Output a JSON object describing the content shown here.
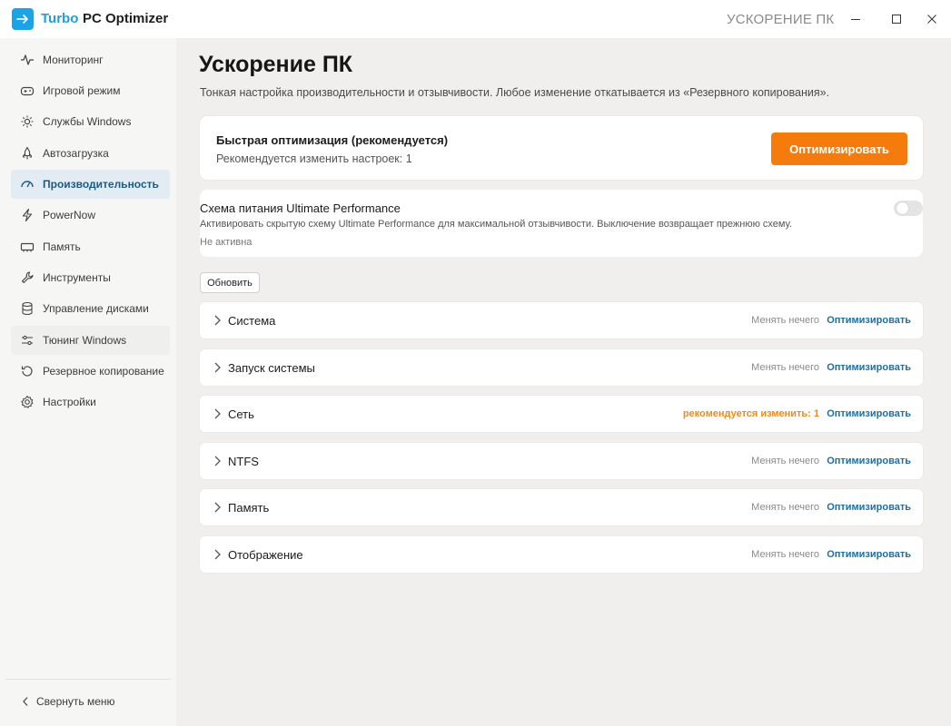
{
  "app": {
    "name_brand": "Turbo",
    "name_rest": "PC Optimizer",
    "window_title": "УСКОРЕНИЕ ПК",
    "accent_color": "#1aa3e6",
    "logo_icon": "arrow-right-icon"
  },
  "window_controls": {
    "minimize_icon": "minimize-icon",
    "maximize_icon": "maximize-icon",
    "close_icon": "close-icon"
  },
  "sidebar": {
    "items": [
      {
        "label": "Мониторинг",
        "icon": "pulse-icon"
      },
      {
        "label": "Игровой режим",
        "icon": "gamepad-icon"
      },
      {
        "label": "Службы Windows",
        "icon": "gear-sun-icon"
      },
      {
        "label": "Автозагрузка",
        "icon": "rocket-icon"
      },
      {
        "label": "Производительность",
        "icon": "speedometer-icon",
        "active": true
      },
      {
        "label": "PowerNow",
        "icon": "lightning-icon"
      },
      {
        "label": "Память",
        "icon": "memory-chip-icon"
      },
      {
        "label": "Инструменты",
        "icon": "wrench-icon"
      },
      {
        "label": "Управление дисками",
        "icon": "database-icon"
      },
      {
        "label": "Тюнинг Windows",
        "icon": "sliders-icon"
      },
      {
        "label": "Резервное копирование",
        "icon": "restore-icon"
      },
      {
        "label": "Настройки",
        "icon": "settings-icon"
      }
    ],
    "collapse_label": "Свернуть меню",
    "collapse_icon": "chevron-left-icon"
  },
  "main": {
    "title": "Ускорение ПК",
    "subtitle": "Тонкая настройка производительности и отзывчивости. Любое изменение откатывается из «Резервного копирования».",
    "quick": {
      "title": "Быстрая оптимизация (рекомендуется)",
      "subtitle": "Рекомендуется изменить настроек: 1",
      "button_label": "Оптимизировать",
      "button_color": "#f57c0c"
    },
    "power": {
      "title": "Схема питания Ultimate Performance",
      "description": "Активировать скрытую схему Ultimate Performance для максимальной отзывчивости. Выключение возвращает прежнюю схему.",
      "status": "Не активна",
      "toggle_on": false
    },
    "refresh_label": "Обновить",
    "sections": [
      {
        "label": "Система",
        "status": "Менять нечего",
        "action": "Оптимизировать",
        "warn": false
      },
      {
        "label": "Запуск системы",
        "status": "Менять нечего",
        "action": "Оптимизировать",
        "warn": false
      },
      {
        "label": "Сеть",
        "status": "рекомендуется изменить: 1",
        "action": "Оптимизировать",
        "warn": true
      },
      {
        "label": "NTFS",
        "status": "Менять нечего",
        "action": "Оптимизировать",
        "warn": false
      },
      {
        "label": "Память",
        "status": "Менять нечего",
        "action": "Оптимизировать",
        "warn": false
      },
      {
        "label": "Отображение",
        "status": "Менять нечего",
        "action": "Оптимизировать",
        "warn": false
      }
    ],
    "warn_color": "#f08a1c",
    "link_color": "#1d6fa5"
  }
}
